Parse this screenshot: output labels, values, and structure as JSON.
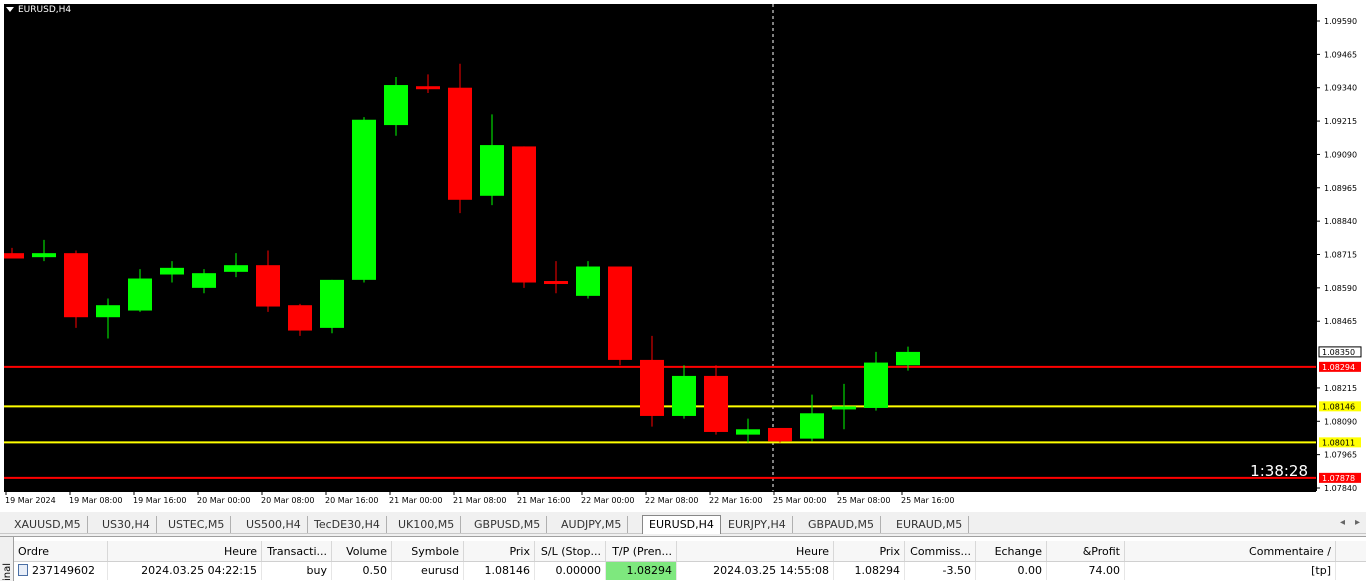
{
  "chart": {
    "symbol_label": "EURUSD,H4",
    "timer": "1:38:28",
    "price_ticks": [
      "1.09590",
      "1.09465",
      "1.09340",
      "1.09215",
      "1.09090",
      "1.08965",
      "1.08840",
      "1.08715",
      "1.08590",
      "1.08465",
      "1.08215",
      "1.08090",
      "1.07965",
      "1.07840"
    ],
    "time_ticks": [
      "19 Mar 2024",
      "19 Mar 08:00",
      "19 Mar 16:00",
      "20 Mar 00:00",
      "20 Mar 08:00",
      "20 Mar 16:00",
      "21 Mar 00:00",
      "21 Mar 08:00",
      "21 Mar 16:00",
      "22 Mar 00:00",
      "22 Mar 08:00",
      "22 Mar 16:00",
      "25 Mar 00:00",
      "25 Mar 08:00",
      "25 Mar 16:00"
    ],
    "lines": [
      {
        "price": 1.08294,
        "label": "1.08294",
        "color": "#ff0000",
        "label_bg": "#ff0000",
        "label_color": "#ffffff"
      },
      {
        "price": 1.08146,
        "label": "1.08146",
        "color": "#ffff00",
        "label_bg": "#ffff00",
        "label_color": "#000000"
      },
      {
        "price": 1.08011,
        "label": "1.08011",
        "color": "#ffff00",
        "label_bg": "#ffff00",
        "label_color": "#000000"
      },
      {
        "price": 1.07878,
        "label": "1.07878",
        "color": "#ff0000",
        "label_bg": "#ff0000",
        "label_color": "#ffffff"
      }
    ],
    "bid_label": "1.08350",
    "bull_color": "#00ff00",
    "bear_color": "#ff0000"
  },
  "chart_data": {
    "type": "candlestick",
    "symbol": "EURUSD",
    "timeframe": "H4",
    "ylim": [
      1.0781,
      1.0963
    ],
    "candles": [
      {
        "o": 1.0872,
        "h": 1.0874,
        "l": 1.087,
        "c": 1.087
      },
      {
        "o": 1.08705,
        "h": 1.0877,
        "l": 1.0869,
        "c": 1.0872
      },
      {
        "o": 1.0872,
        "h": 1.0873,
        "l": 1.0844,
        "c": 1.0848
      },
      {
        "o": 1.0848,
        "h": 1.0855,
        "l": 1.084,
        "c": 1.08525
      },
      {
        "o": 1.08505,
        "h": 1.0866,
        "l": 1.085,
        "c": 1.08625
      },
      {
        "o": 1.0864,
        "h": 1.0869,
        "l": 1.0861,
        "c": 1.08665
      },
      {
        "o": 1.0859,
        "h": 1.0866,
        "l": 1.0857,
        "c": 1.08645
      },
      {
        "o": 1.0865,
        "h": 1.0872,
        "l": 1.0863,
        "c": 1.08675
      },
      {
        "o": 1.08675,
        "h": 1.0873,
        "l": 1.085,
        "c": 1.0852
      },
      {
        "o": 1.08525,
        "h": 1.0853,
        "l": 1.0841,
        "c": 1.0843
      },
      {
        "o": 1.0844,
        "h": 1.0862,
        "l": 1.0842,
        "c": 1.0862
      },
      {
        "o": 1.0862,
        "h": 1.0923,
        "l": 1.0861,
        "c": 1.0922
      },
      {
        "o": 1.092,
        "h": 1.0938,
        "l": 1.0916,
        "c": 1.0935
      },
      {
        "o": 1.0934,
        "h": 1.0939,
        "l": 1.0932,
        "c": 1.0933
      },
      {
        "o": 1.0934,
        "h": 1.0943,
        "l": 1.0887,
        "c": 1.0892
      },
      {
        "o": 1.08935,
        "h": 1.0924,
        "l": 1.089,
        "c": 1.09125
      },
      {
        "o": 1.0912,
        "h": 1.0912,
        "l": 1.0859,
        "c": 1.0861
      },
      {
        "o": 1.0861,
        "h": 1.0869,
        "l": 1.0857,
        "c": 1.086
      },
      {
        "o": 1.0856,
        "h": 1.0869,
        "l": 1.0855,
        "c": 1.0867
      },
      {
        "o": 1.0867,
        "h": 1.0867,
        "l": 1.083,
        "c": 1.0832
      },
      {
        "o": 1.0832,
        "h": 1.0841,
        "l": 1.0807,
        "c": 1.0811
      },
      {
        "o": 1.0811,
        "h": 1.083,
        "l": 1.081,
        "c": 1.0826
      },
      {
        "o": 1.0826,
        "h": 1.083,
        "l": 1.0804,
        "c": 1.0805
      },
      {
        "o": 1.0804,
        "h": 1.081,
        "l": 1.0801,
        "c": 1.0806
      },
      {
        "o": 1.08065,
        "h": 1.08065,
        "l": 1.0801,
        "c": 1.08015
      },
      {
        "o": 1.08025,
        "h": 1.0819,
        "l": 1.08015,
        "c": 1.0812
      },
      {
        "o": 1.0813,
        "h": 1.0823,
        "l": 1.0806,
        "c": 1.0814
      },
      {
        "o": 1.0814,
        "h": 1.0835,
        "l": 1.0813,
        "c": 1.0831
      },
      {
        "o": 1.083,
        "h": 1.0837,
        "l": 1.0828,
        "c": 1.0835
      }
    ]
  },
  "symbol_tabs": [
    "XAUUSD,M5",
    "US30,H4",
    "USTEC,M5",
    "US500,H4",
    "TecDE30,H4",
    "UK100,M5",
    "GBPUSD,M5",
    "AUDJPY,M5",
    "EURUSD,H4",
    "EURJPY,H4",
    "GBPAUD,M5",
    "EURAUD,M5"
  ],
  "active_tab": "EURUSD,H4",
  "terminal": {
    "side_label": "inal",
    "columns": [
      "Ordre",
      "Heure",
      "Transacti...",
      "Volume",
      "Symbole",
      "Prix",
      "S/L (Stop...",
      "T/P (Pren...",
      "Heure",
      "Prix",
      "Commiss...",
      "Echange",
      "&Profit",
      "Commentaire"
    ],
    "rows": [
      {
        "ordre": "237149602",
        "heure": "2024.03.25 04:22:15",
        "type": "buy",
        "volume": "0.50",
        "symbole": "eurusd",
        "prix": "1.08146",
        "sl": "0.00000",
        "tp": "1.08294",
        "heure2": "2024.03.25 14:55:08",
        "prix2": "1.08294",
        "commission": "-3.50",
        "echange": "0.00",
        "profit": "74.00",
        "commentaire": "[tp]"
      }
    ]
  }
}
